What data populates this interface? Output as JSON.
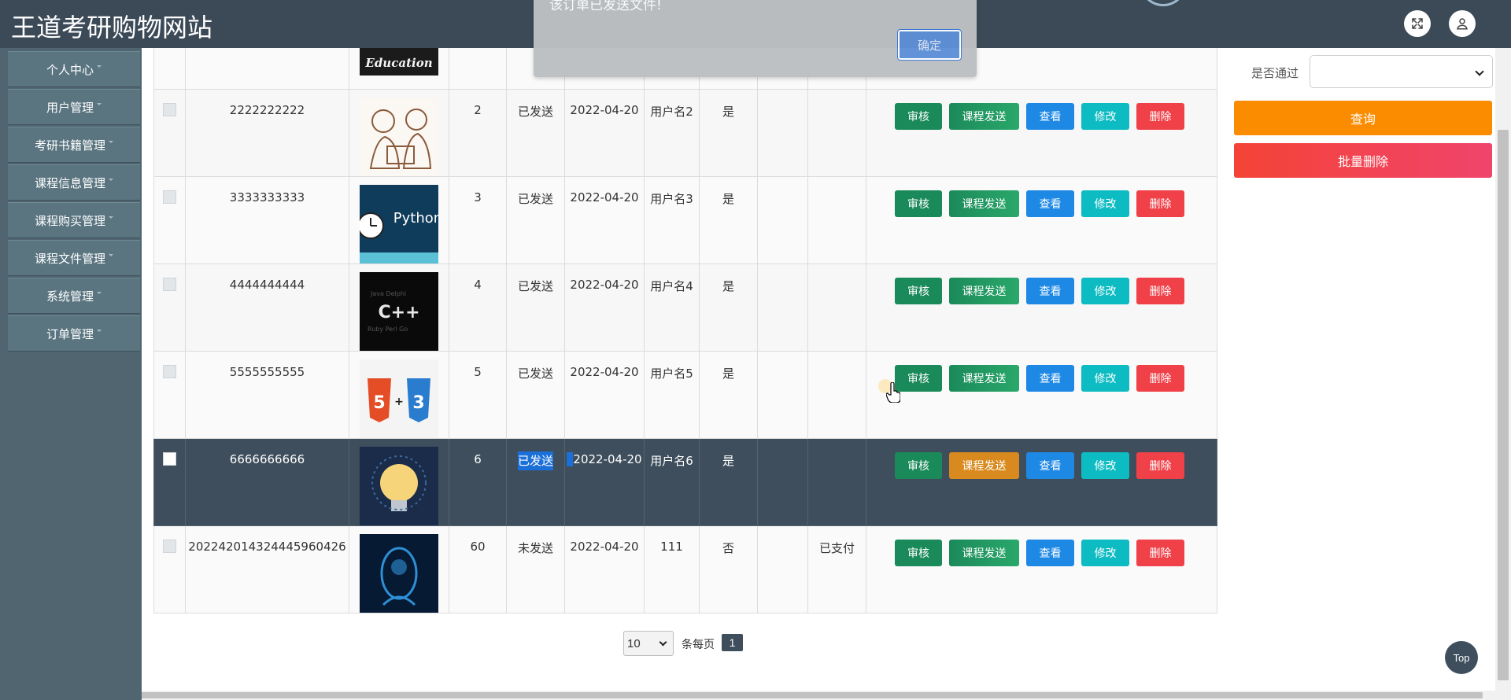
{
  "header": {
    "site_title": "王道考研购物网站",
    "icons": [
      "fullscreen-icon",
      "user-icon"
    ]
  },
  "sidebar": {
    "items": [
      {
        "label": "个人中心"
      },
      {
        "label": "用户管理"
      },
      {
        "label": "考研书籍管理"
      },
      {
        "label": "课程信息管理"
      },
      {
        "label": "课程购买管理"
      },
      {
        "label": "课程文件管理"
      },
      {
        "label": "系统管理"
      },
      {
        "label": "订单管理"
      }
    ]
  },
  "table": {
    "first_row_image": "Education",
    "rows": [
      {
        "order_no": "2222222222",
        "image": "programmers-sketch",
        "qty": "2",
        "send_status": "已发送",
        "date": "2022-04-20",
        "username": "用户名2",
        "approved": "是",
        "col8": "",
        "pay_status": ""
      },
      {
        "order_no": "3333333333",
        "image": "python-clock",
        "image_text": "Python",
        "qty": "3",
        "send_status": "已发送",
        "date": "2022-04-20",
        "username": "用户名3",
        "approved": "是",
        "col8": "",
        "pay_status": ""
      },
      {
        "order_no": "4444444444",
        "image": "cpp-wordcloud",
        "image_text": "C++",
        "qty": "4",
        "send_status": "已发送",
        "date": "2022-04-20",
        "username": "用户名4",
        "approved": "是",
        "col8": "",
        "pay_status": ""
      },
      {
        "order_no": "5555555555",
        "image": "html5-css3",
        "qty": "5",
        "send_status": "已发送",
        "date": "2022-04-20",
        "username": "用户名5",
        "approved": "是",
        "col8": "",
        "pay_status": ""
      },
      {
        "order_no": "6666666666",
        "image": "lightbulb",
        "qty": "6",
        "send_status": "已发送",
        "date": "2022-04-20",
        "username": "用户名6",
        "approved": "是",
        "col8": "",
        "pay_status": ""
      },
      {
        "order_no": "202242014324445960426",
        "image": "blue-ai-head",
        "qty": "60",
        "send_status": "未发送",
        "date": "2022-04-20",
        "username": "111",
        "approved": "否",
        "col8": "",
        "pay_status": "已支付"
      }
    ],
    "actions": {
      "audit": "审核",
      "send_course": "课程发送",
      "view": "查看",
      "edit": "修改",
      "delete": "删除"
    },
    "highlighted_row_index": 4
  },
  "filter": {
    "approved_label": "是否通过",
    "approved_value": "",
    "query_button": "查询",
    "bulk_delete_button": "批量删除"
  },
  "pagination": {
    "page_size": "10",
    "per_page_label": "条每页",
    "current_page": "1"
  },
  "top_button": "Top",
  "alert": {
    "message": "该订单已发送文件!",
    "ok_button": "确定"
  },
  "colors": {
    "header_bg": "#3c4a58",
    "sidebar_bg": "#506570",
    "audit": "#1b8a5a",
    "view": "#1e88e5",
    "edit": "#0dbbc2",
    "delete": "#f04048",
    "query": "#fb8c00"
  }
}
